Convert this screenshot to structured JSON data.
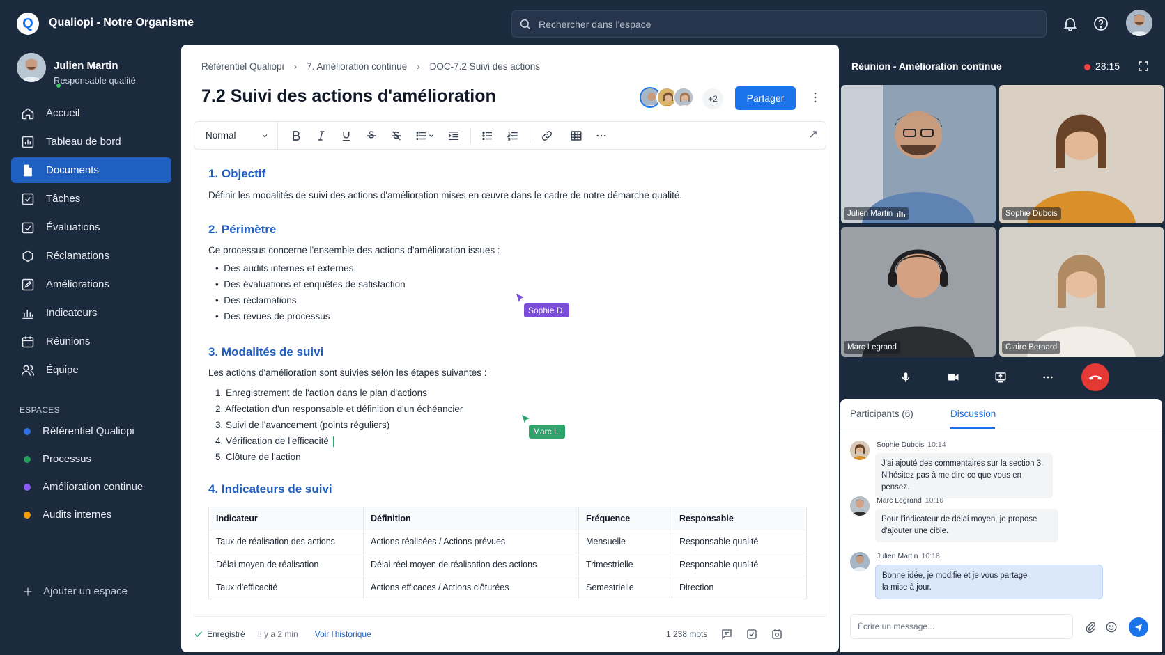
{
  "header": {
    "logo_letter": "Q",
    "org_name": "Qualiopi - Notre Organisme",
    "search_placeholder": "Rechercher dans l'espace"
  },
  "user": {
    "name": "Julien Martin",
    "role": "Responsable qualité"
  },
  "nav": {
    "items": [
      {
        "label": "Accueil",
        "icon": "home-icon",
        "active": false
      },
      {
        "label": "Tableau de bord",
        "icon": "dashboard-icon",
        "active": false
      },
      {
        "label": "Documents",
        "icon": "document-icon",
        "active": true
      },
      {
        "label": "Tâches",
        "icon": "checkbox-icon",
        "active": false
      },
      {
        "label": "Évaluations",
        "icon": "evaluation-icon",
        "active": false
      },
      {
        "label": "Réclamations",
        "icon": "complaint-icon",
        "active": false
      },
      {
        "label": "Améliorations",
        "icon": "edit-icon",
        "active": false
      },
      {
        "label": "Indicateurs",
        "icon": "bar-chart-icon",
        "active": false
      },
      {
        "label": "Réunions",
        "icon": "calendar-icon",
        "active": false
      },
      {
        "label": "Équipe",
        "icon": "team-icon",
        "active": false
      }
    ]
  },
  "spaces": {
    "title": "ESPACES",
    "items": [
      {
        "label": "Référentiel Qualiopi",
        "color": "#2f6fe4"
      },
      {
        "label": "Processus",
        "color": "#22a05b"
      },
      {
        "label": "Amélioration continue",
        "color": "#8b5cf6"
      },
      {
        "label": "Audits internes",
        "color": "#f59e0b"
      }
    ],
    "add_label": "Ajouter un espace"
  },
  "editor": {
    "breadcrumb": [
      "Référentiel Qualiopi",
      "7. Amélioration continue",
      "DOC-7.2 Suivi des actions"
    ],
    "title": "7.2 Suivi des actions d'amélioration",
    "extra_collaborators": "+2",
    "share_label": "Partager",
    "style_select": "Normal",
    "sections": {
      "s1_title": "1. Objectif",
      "s1_text": "Définir les modalités de suivi des actions d'amélioration mises en œuvre dans le cadre de notre démarche qualité.",
      "s2_title": "2. Périmètre",
      "s2_text": "Ce processus concerne l'ensemble des actions d'amélioration issues :",
      "s2_items": [
        "Des audits internes et externes",
        "Des évaluations et enquêtes de satisfaction",
        "Des réclamations",
        "Des revues de processus"
      ],
      "s3_title": "3. Modalités de suivi",
      "s3_text": "Les actions d'amélioration sont suivies selon les étapes suivantes :",
      "s3_items": [
        "1. Enregistrement de l'action dans le plan d'actions",
        "2. Affectation d'un responsable et définition d'un échéancier",
        "3. Suivi de l'avancement (points réguliers)",
        "4. Vérification de l'efficacité",
        "5. Clôture de l'action"
      ],
      "s4_title": "4. Indicateurs de suivi"
    },
    "cursors": {
      "sophie": "Sophie D.",
      "marc": "Marc L.",
      "sophie_color": "#7c4ddb",
      "marc_color": "#2ea36b"
    },
    "table": {
      "headers": [
        "Indicateur",
        "Définition",
        "Fréquence",
        "Responsable"
      ],
      "rows": [
        [
          "Taux de réalisation des actions",
          "Actions réalisées / Actions prévues",
          "Mensuelle",
          "Responsable qualité"
        ],
        [
          "Délai moyen de réalisation",
          "Délai réel moyen de réalisation des actions",
          "Trimestrielle",
          "Responsable qualité"
        ],
        [
          "Taux d'efficacité",
          "Actions efficaces / Actions clôturées",
          "Semestrielle",
          "Direction"
        ]
      ]
    },
    "footer": {
      "saved": "Enregistré",
      "saved_time": "Il y a 2 min",
      "history": "Voir l'historique",
      "words": "1 238 mots"
    }
  },
  "meeting": {
    "title": "Réunion - Amélioration continue",
    "time": "28:15",
    "participants": [
      {
        "name": "Julien Martin",
        "bg": "#6b84a0",
        "speaking": true
      },
      {
        "name": "Sophie Dubois",
        "bg": "#c99a62"
      },
      {
        "name": "Marc Legrand",
        "bg": "#7b7c82"
      },
      {
        "name": "Claire Bernard",
        "bg": "#b9a48e"
      }
    ]
  },
  "chat": {
    "tab_participants": "Participants (6)",
    "tab_discussion": "Discussion",
    "messages": [
      {
        "author": "Sophie Dubois",
        "time": "10:14",
        "line1": "J'ai ajouté des commentaires sur la section 3.",
        "line2": "N'hésitez pas à me dire ce que vous en pensez."
      },
      {
        "author": "Marc Legrand",
        "time": "10:16",
        "line1": "Pour l'indicateur de délai moyen, je propose",
        "line2": "d'ajouter une cible."
      },
      {
        "author": "Julien Martin",
        "time": "10:18",
        "line1": "Bonne idée, je modifie et je vous partage",
        "line2": "la mise à jour."
      }
    ],
    "compose_placeholder": "Écrire un message..."
  }
}
